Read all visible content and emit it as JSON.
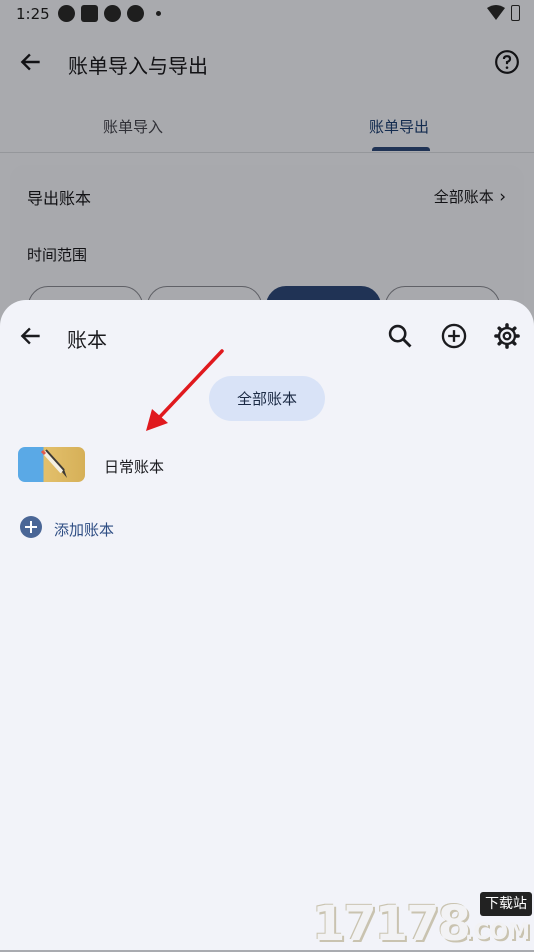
{
  "status_bar": {
    "time": "1:25"
  },
  "background": {
    "title": "账单导入与导出",
    "tabs": [
      {
        "label": "账单导入",
        "selected": false
      },
      {
        "label": "账单导出",
        "selected": true
      }
    ],
    "export_card": {
      "export_label": "导出账本",
      "export_value": "全部账本",
      "time_range_label": "时间范围"
    }
  },
  "sheet": {
    "title": "账本",
    "filter_pill": "全部账本",
    "books": [
      {
        "name": "日常账本"
      }
    ],
    "add_book_label": "添加账本"
  },
  "watermark": {
    "digits": "17178",
    "tag": "下载站",
    "suffix": ".COM"
  },
  "colors": {
    "accent": "#2e4a7a",
    "pill_bg": "#d9e3f7",
    "sheet_bg": "#f2f3f9",
    "annotation_arrow": "#e0191e"
  }
}
